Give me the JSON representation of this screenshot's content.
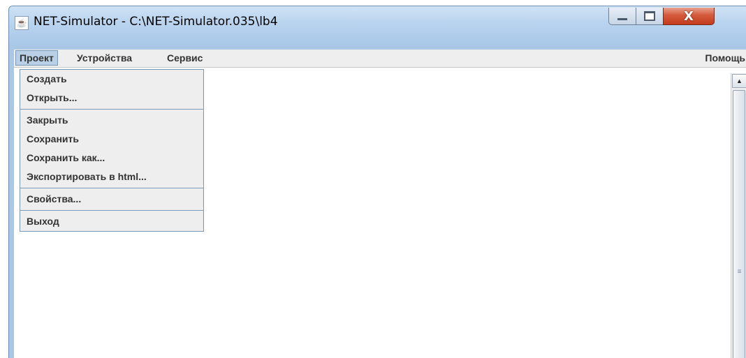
{
  "window": {
    "title": "NET-Simulator - C:\\NET-Simulator.035\\lb4",
    "icon": "java-app-icon",
    "controls": {
      "minimize_icon": "minimize-icon",
      "maximize_icon": "maximize-icon",
      "close_icon": "close-icon",
      "close_glyph": "X",
      "close_color": "#c23b1c"
    }
  },
  "menubar": {
    "items": [
      "Проект",
      "Устройства",
      "Сервис"
    ],
    "help": "Помощь",
    "active_index": 0,
    "active_color": "#b8cfe5"
  },
  "dropdown": {
    "groups": [
      [
        "Создать",
        "Открыть..."
      ],
      [
        "Закрыть",
        "Сохранить",
        "Сохранить как...",
        "Экспортировать в html..."
      ],
      [
        "Свойства..."
      ],
      [
        "Выход"
      ]
    ]
  },
  "scrollbar": {
    "up_icon": "scroll-up-arrow-icon",
    "grip_icon": "scroll-grip-icon"
  }
}
